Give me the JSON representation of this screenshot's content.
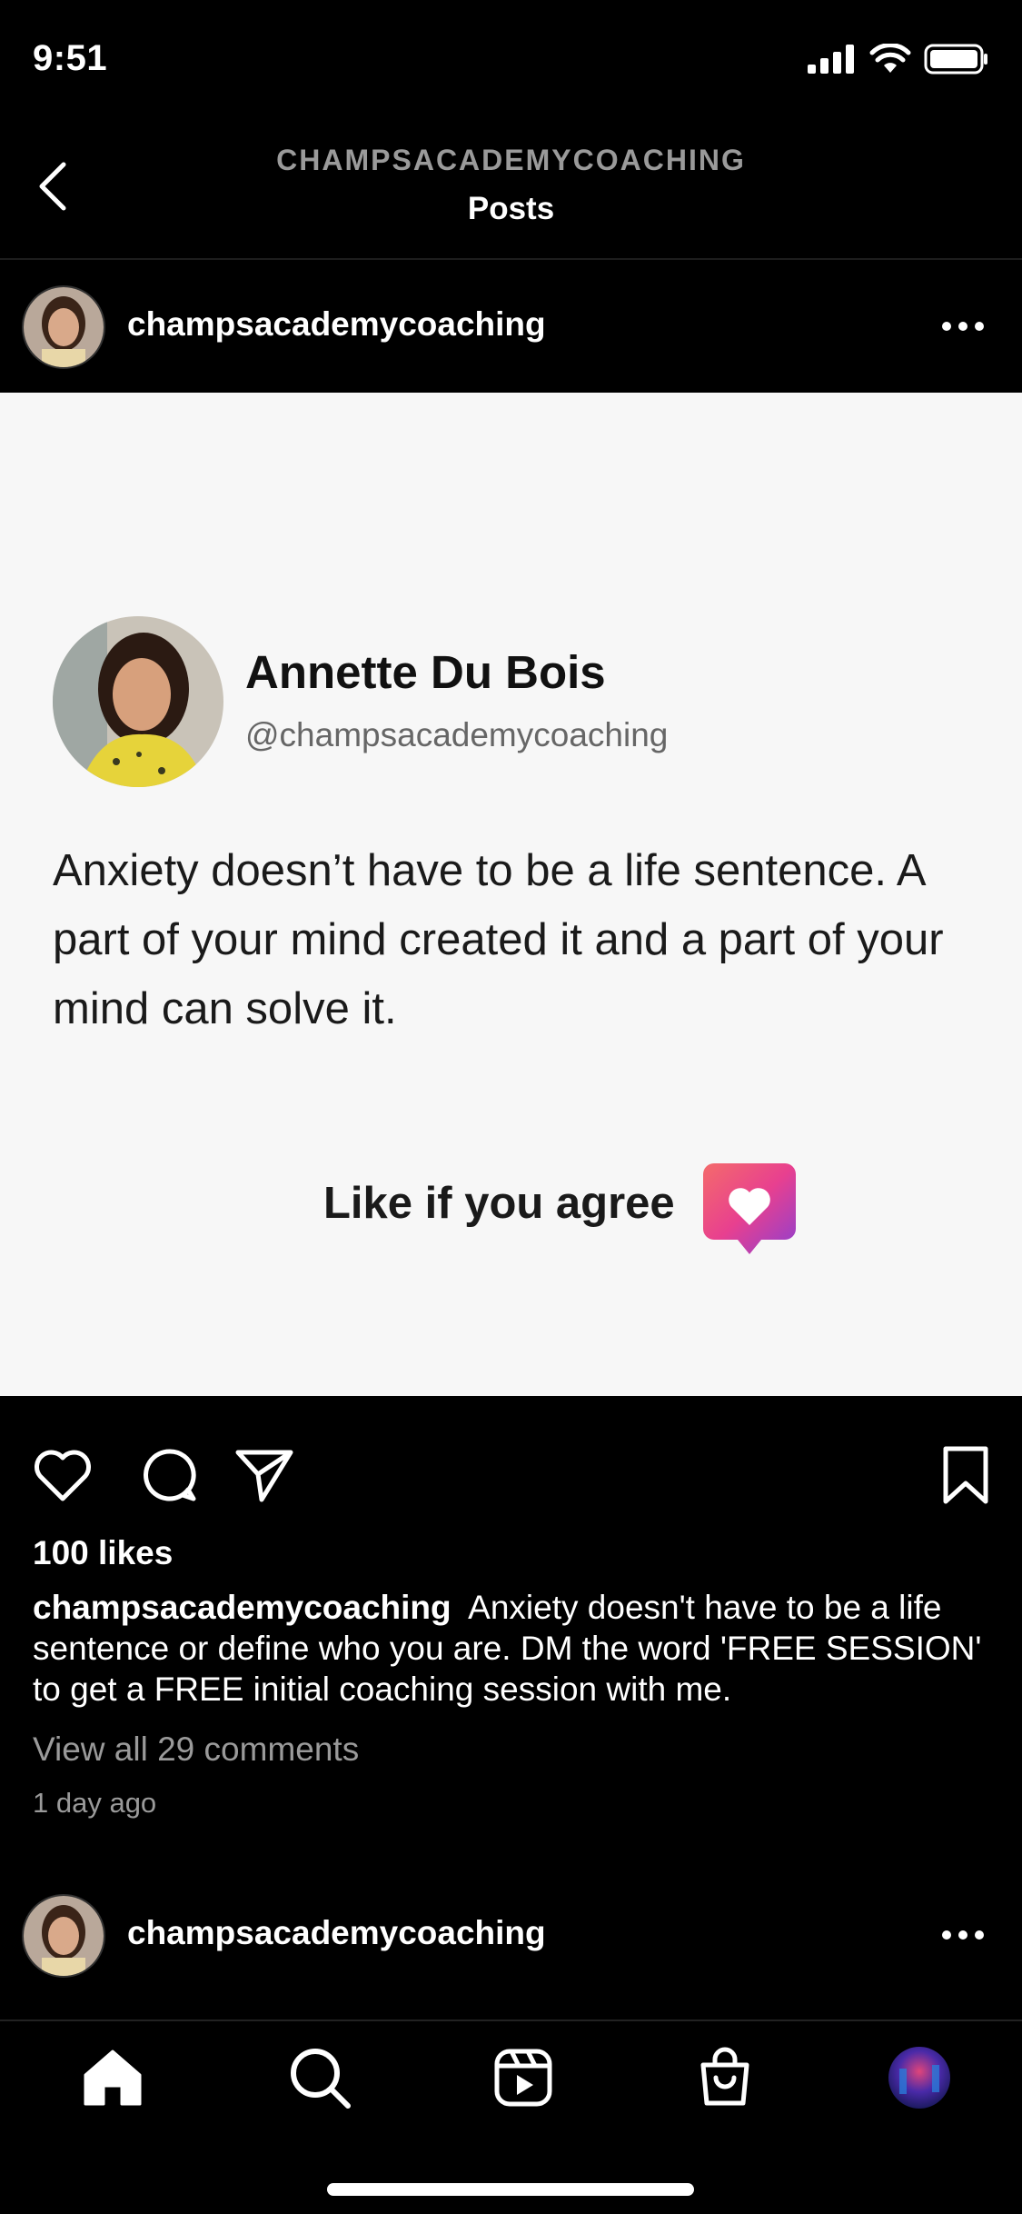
{
  "status": {
    "time": "9:51"
  },
  "header": {
    "subtitle": "CHAMPSACADEMYCOACHING",
    "title": "Posts"
  },
  "post": {
    "username": "champsacademycoaching",
    "card": {
      "name": "Annette Du Bois",
      "handle": "@champsacademycoaching",
      "quote": "Anxiety doesn’t have to be a life sentence. A part of your mind created it and a part of your mind can solve it.",
      "cta": "Like if you agree"
    },
    "likes": "100 likes",
    "caption_user": "champsacademycoaching",
    "caption_text": "Anxiety doesn't have to be a life sentence or define who you are. DM the word 'FREE SESSION' to get a FREE initial coaching session with me.",
    "comments_link": "View all 29 comments",
    "time_ago": "1 day ago"
  },
  "next_post": {
    "username": "champsacademycoaching"
  },
  "icons": {
    "back": "chevron-left-icon",
    "more": "more-horizontal-icon",
    "like": "heart-icon",
    "comment": "comment-icon",
    "share": "send-icon",
    "save": "bookmark-icon",
    "home": "home-icon",
    "search": "search-icon",
    "reels": "reels-icon",
    "shop": "shopping-bag-icon",
    "profile": "profile-avatar"
  },
  "colors": {
    "background": "#000000",
    "card": "#f7f7f7",
    "muted": "#9a9a9a",
    "badge_start": "#f05a8c",
    "badge_end": "#8e3fd0"
  }
}
